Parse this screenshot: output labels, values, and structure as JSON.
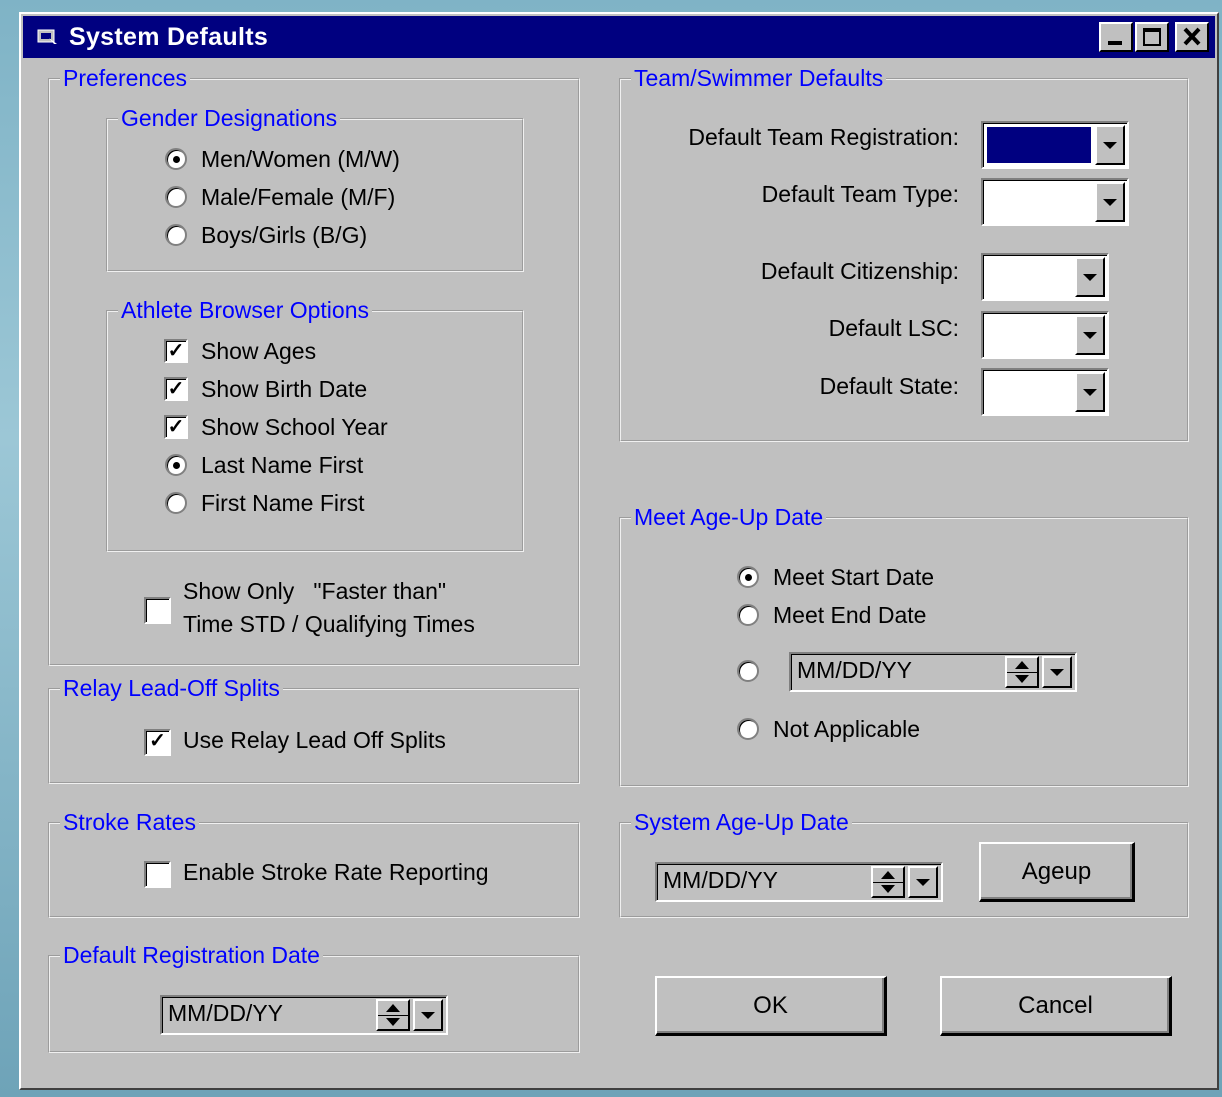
{
  "window": {
    "title": "System Defaults"
  },
  "preferences": {
    "title": "Preferences",
    "gender": {
      "title": "Gender Designations",
      "options": [
        "Men/Women (M/W)",
        "Male/Female (M/F)",
        "Boys/Girls (B/G)"
      ],
      "selected": 0
    },
    "athlete_browser": {
      "title": "Athlete Browser Options",
      "show_ages": "Show Ages",
      "show_birth_date": "Show Birth Date",
      "show_school_year": "Show School Year",
      "last_name_first": "Last Name First",
      "first_name_first": "First Name First"
    },
    "faster_line1": "Show Only   \"Faster than\"",
    "faster_line2": "Time STD / Qualifying Times"
  },
  "relay": {
    "title": "Relay Lead-Off Splits",
    "label": "Use Relay Lead Off Splits"
  },
  "stroke": {
    "title": "Stroke Rates",
    "label": "Enable Stroke Rate Reporting"
  },
  "registration": {
    "title": "Default Registration Date",
    "date": "MM/DD/YY"
  },
  "team_defaults": {
    "title": "Team/Swimmer Defaults",
    "team_registration": "Default Team Registration:",
    "team_type": "Default Team Type:",
    "citizenship": "Default Citizenship:",
    "lsc": "Default LSC:",
    "state": "Default State:"
  },
  "meet_ageup": {
    "title": "Meet Age-Up Date",
    "start": "Meet Start Date",
    "end": "Meet End Date",
    "date": "MM/DD/YY",
    "na": "Not Applicable"
  },
  "system_ageup": {
    "title": "System Age-Up Date",
    "date": "MM/DD/YY",
    "button": "Ageup"
  },
  "buttons": {
    "ok": "OK",
    "cancel": "Cancel"
  }
}
